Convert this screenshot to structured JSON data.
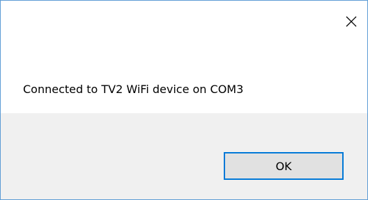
{
  "dialog": {
    "message": "Connected to TV2 WiFi device on COM3",
    "ok_label": "OK",
    "close_icon": "close-icon"
  },
  "colors": {
    "border": "#5b9bd5",
    "footer_bg": "#f0f0f0",
    "button_bg": "#e1e1e1",
    "button_border": "#0078d7"
  }
}
